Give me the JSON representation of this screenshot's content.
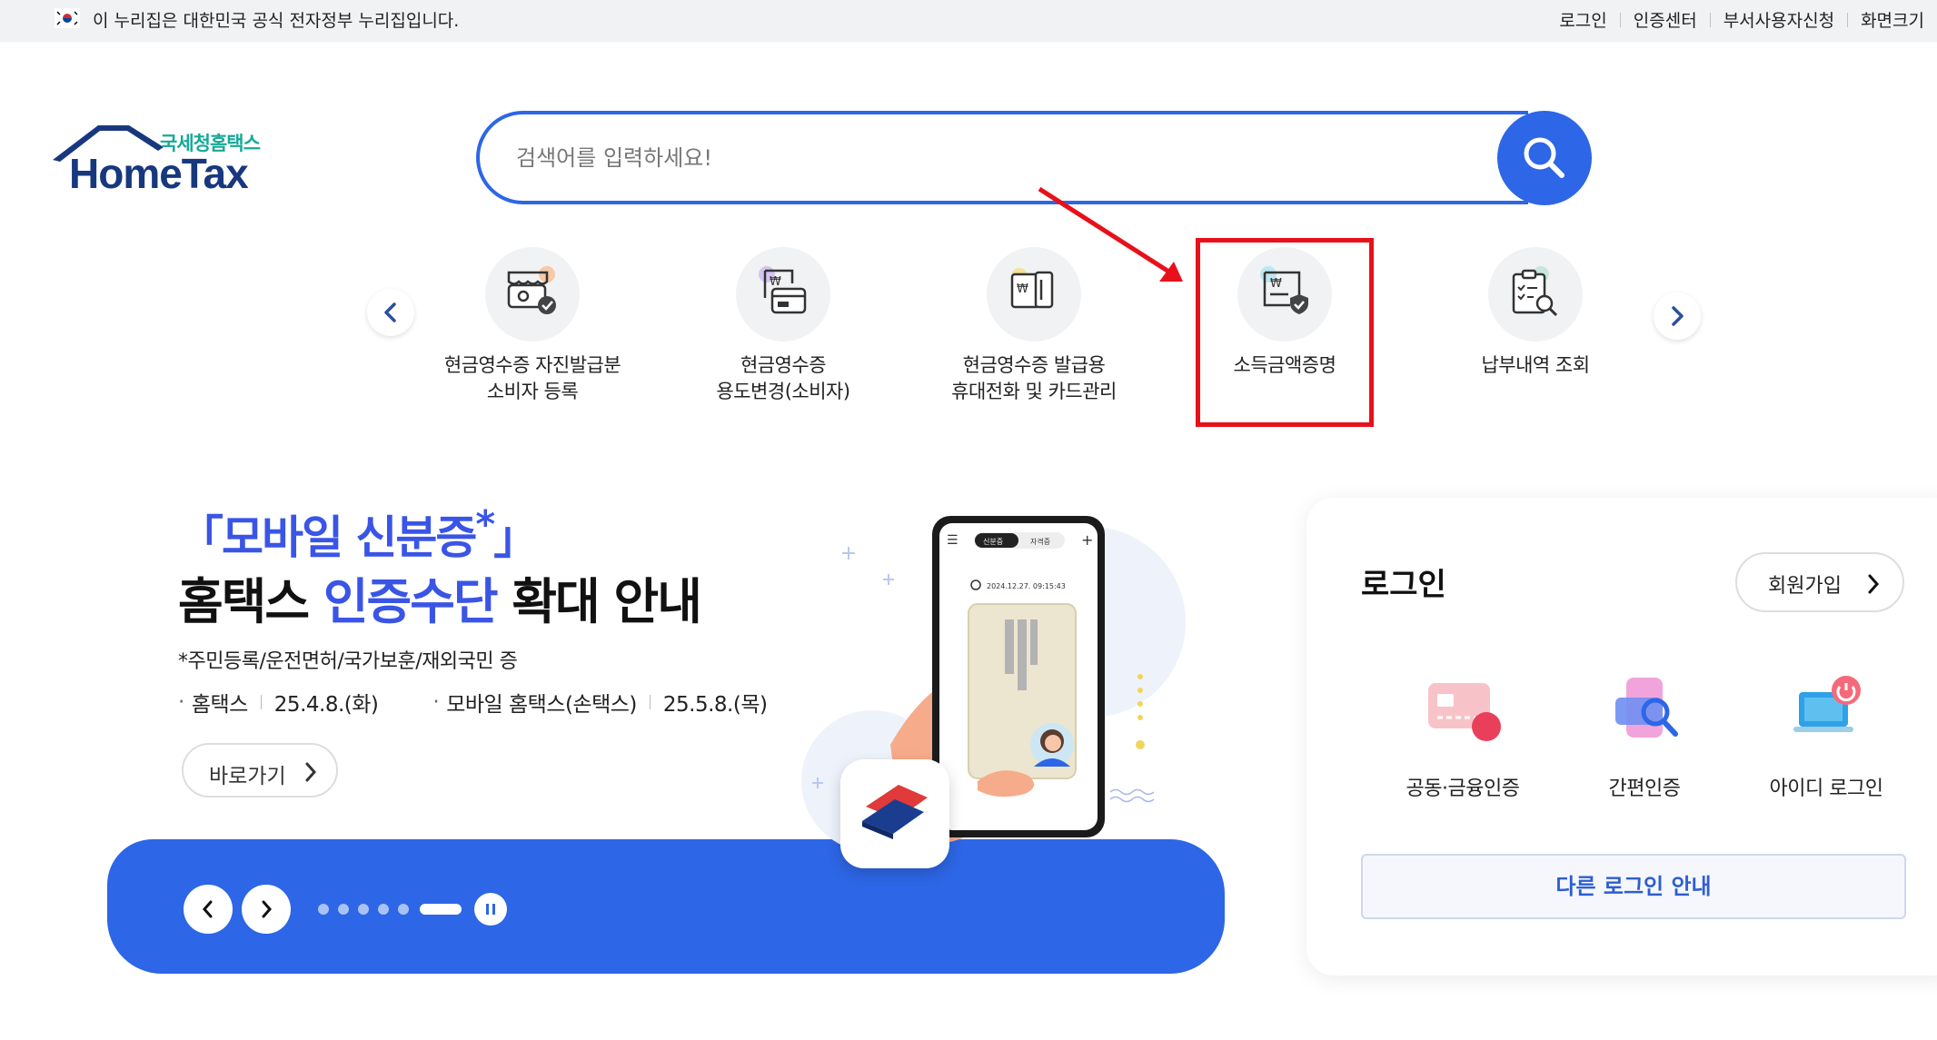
{
  "gov_bar": {
    "notice": "이 누리집은 대한민국 공식 전자정부 누리집입니다.",
    "links": [
      "로그인",
      "인증센터",
      "부서사용자신청",
      "화면크기"
    ]
  },
  "logo": {
    "sub": "국세청홈택스",
    "main": "HomeTax"
  },
  "search": {
    "placeholder": "검색어를 입력하세요!"
  },
  "quick_menu": {
    "items": [
      {
        "line1": "현금영수증 자진발급분",
        "line2": "소비자 등록",
        "icon": "cash-receipt-register-icon"
      },
      {
        "line1": "현금영수증",
        "line2": "용도변경(소비자)",
        "icon": "receipt-card-icon"
      },
      {
        "line1": "현금영수증 발급용",
        "line2": "휴대전화 및 카드관리",
        "icon": "phone-card-icon"
      },
      {
        "line1": "소득금액증명",
        "line2": "",
        "icon": "income-certificate-icon"
      },
      {
        "line1": "납부내역 조회",
        "line2": "",
        "icon": "payment-history-search-icon"
      }
    ],
    "highlight_color": "#e8101a"
  },
  "banner": {
    "title1_open": "「",
    "title1_text": "모바일 신분증",
    "title1_star": "*",
    "title1_close": "」",
    "title2_a": "홈택스 ",
    "title2_b": "인증수단",
    "title2_c": " 확대 안내",
    "note": "*주민등록/운전면허/국가보훈/재외국민 증",
    "date1_label": "홈택스",
    "date1_value": "25.4.8.(화)",
    "date2_label": "모바일 홈택스(손택스)",
    "date2_value": "25.5.8.(목)",
    "go_button": "바로가기",
    "phone_tab1": "신분증",
    "phone_tab2": "자격증",
    "phone_time": "2024.12.27. 09:15:43",
    "slides": 6,
    "active_slide": 6
  },
  "login": {
    "title": "로그인",
    "join_button": "회원가입",
    "options": [
      {
        "label": "공동·금융인증",
        "icon": "certificate-card-icon"
      },
      {
        "label": "간편인증",
        "icon": "simple-auth-icon"
      },
      {
        "label": "아이디 로그인",
        "icon": "id-login-laptop-icon"
      }
    ],
    "other_button": "다른 로그인 안내"
  },
  "colors": {
    "primary": "#2d66e6",
    "title_blue": "#3a55e6",
    "logo_navy": "#17387e",
    "logo_teal": "#18a999"
  }
}
